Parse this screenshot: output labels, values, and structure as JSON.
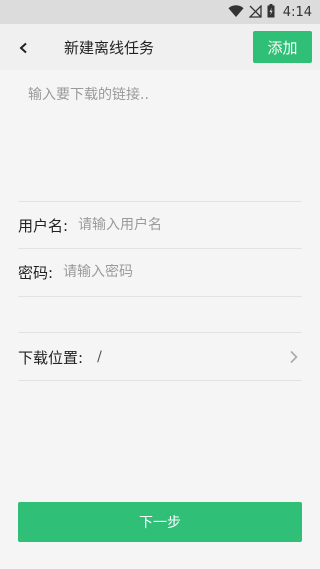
{
  "status_bar": {
    "time": "4:14",
    "icons": [
      "wifi-icon",
      "no-signal-icon",
      "battery-icon"
    ]
  },
  "app_bar": {
    "back_icon": "back-arrow-icon",
    "title": "新建离线任务",
    "add_label": "添加"
  },
  "form": {
    "link_placeholder": "输入要下载的链接..",
    "username_label": "用户名:",
    "username_placeholder": "请输入用户名",
    "password_label": "密码:",
    "password_placeholder": "请输入密码",
    "location_label": "下载位置:",
    "location_value": "/",
    "location_icon": "chevron-right-icon"
  },
  "footer": {
    "next_label": "下一步"
  },
  "colors": {
    "accent": "#2fbf76",
    "background": "#f5f5f5",
    "app_bar": "#f0f0f0",
    "status_bar": "#dcdcdc"
  }
}
